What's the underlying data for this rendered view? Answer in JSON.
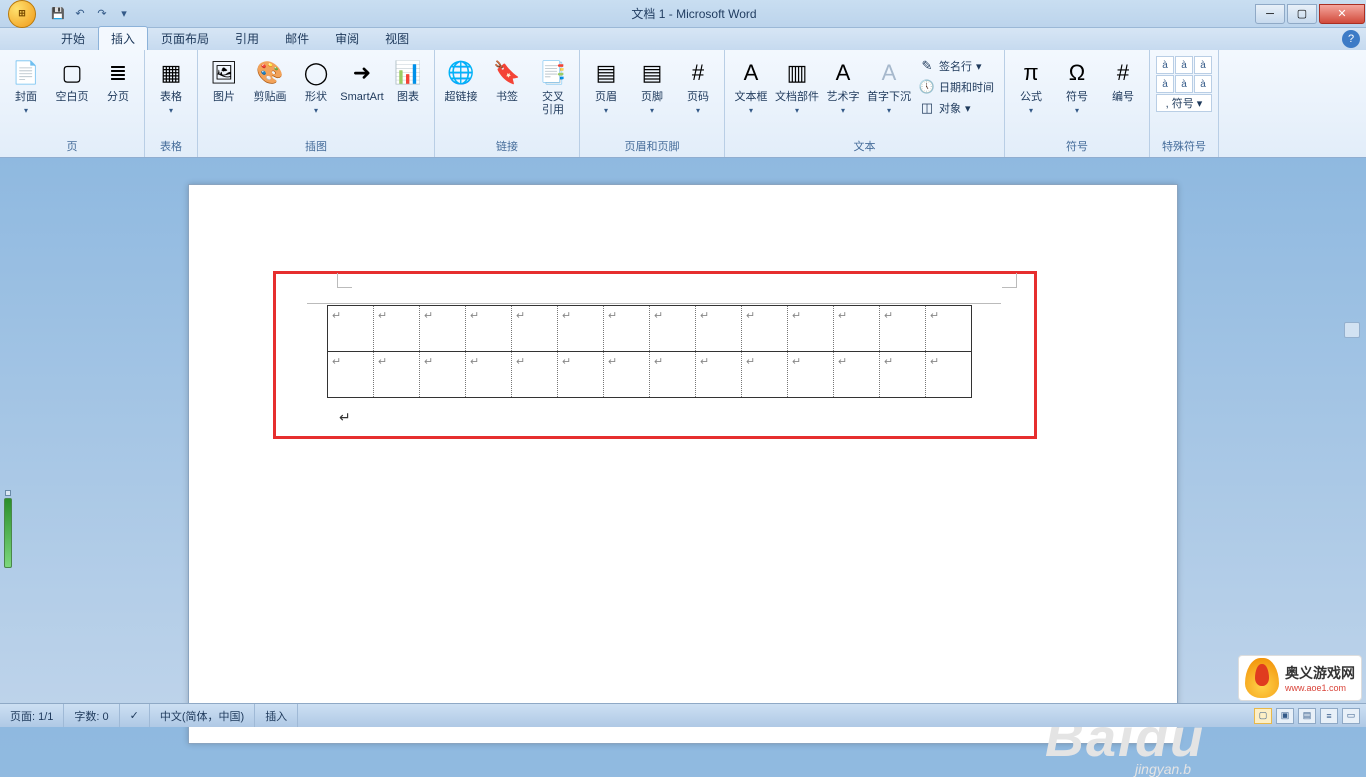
{
  "title": "文档 1 - Microsoft Word",
  "qat": {
    "save": "💾",
    "undo": "↶",
    "redo": "↷",
    "more": "▾"
  },
  "tabs": [
    "开始",
    "插入",
    "页面布局",
    "引用",
    "邮件",
    "审阅",
    "视图"
  ],
  "active_tab": 1,
  "ribbon": {
    "groups": [
      {
        "label": "页",
        "items": [
          {
            "label": "封面",
            "arrow": true,
            "icon": "📄"
          },
          {
            "label": "空白页",
            "icon": "▢"
          },
          {
            "label": "分页",
            "icon": "≣"
          }
        ]
      },
      {
        "label": "表格",
        "items": [
          {
            "label": "表格",
            "arrow": true,
            "icon": "▦"
          }
        ]
      },
      {
        "label": "插图",
        "items": [
          {
            "label": "图片",
            "icon": "🖼"
          },
          {
            "label": "剪贴画",
            "icon": "🎨"
          },
          {
            "label": "形状",
            "arrow": true,
            "icon": "◯"
          },
          {
            "label": "SmartArt",
            "icon": "➜"
          },
          {
            "label": "图表",
            "icon": "📊"
          }
        ]
      },
      {
        "label": "链接",
        "items": [
          {
            "label": "超链接",
            "icon": "🌐"
          },
          {
            "label": "书签",
            "icon": "🔖"
          },
          {
            "label": "交叉\n引用",
            "icon": "📑"
          }
        ]
      },
      {
        "label": "页眉和页脚",
        "items": [
          {
            "label": "页眉",
            "arrow": true,
            "icon": "▤"
          },
          {
            "label": "页脚",
            "arrow": true,
            "icon": "▤"
          },
          {
            "label": "页码",
            "arrow": true,
            "icon": "#"
          }
        ]
      },
      {
        "label": "文本",
        "items": [
          {
            "label": "文本框",
            "arrow": true,
            "icon": "A"
          },
          {
            "label": "文档部件",
            "arrow": true,
            "icon": "▥"
          },
          {
            "label": "艺术字",
            "arrow": true,
            "icon": "A"
          },
          {
            "label": "首字下沉",
            "arrow": true,
            "icon": "A",
            "disabled": true
          }
        ],
        "side": [
          {
            "label": "签名行",
            "icon": "✎",
            "arrow": true
          },
          {
            "label": "日期和时间",
            "icon": "🕔"
          },
          {
            "label": "对象",
            "icon": "◫",
            "arrow": true
          }
        ]
      },
      {
        "label": "符号",
        "items": [
          {
            "label": "公式",
            "arrow": true,
            "icon": "π"
          },
          {
            "label": "符号",
            "arrow": true,
            "icon": "Ω"
          },
          {
            "label": "编号",
            "icon": "#"
          }
        ]
      },
      {
        "label": "特殊符号",
        "grid": [
          "à",
          "à",
          "à",
          "à",
          "à",
          "à",
          ", 符号 ▾"
        ]
      }
    ]
  },
  "doc": {
    "table": {
      "rows": 2,
      "cols": 14,
      "mark": "↵"
    },
    "cursor": "↵"
  },
  "status": {
    "page": "页面: 1/1",
    "words": "字数: 0",
    "lang": "中文(简体，中国)",
    "mode": "插入"
  },
  "watermark": {
    "text": "Baidu",
    "sub": "jingyan.b"
  },
  "badge": {
    "text": "奥义游戏网",
    "url": "www.aoe1.com"
  }
}
